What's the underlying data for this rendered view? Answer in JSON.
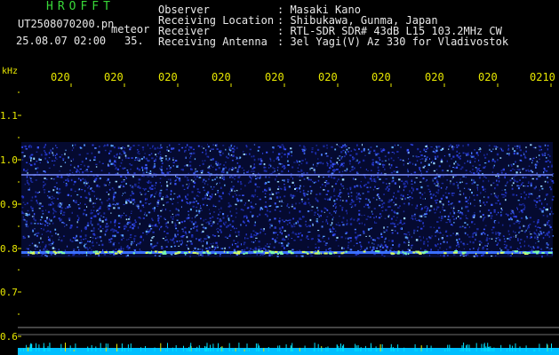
{
  "header": {
    "app_title": "HROFFT",
    "file_name": "UT2508070200.pn",
    "file_suffix": "meteor",
    "datetime": "25.08.07 02:00",
    "count": "35.",
    "info": [
      {
        "label": "Observer",
        "value": ": Masaki Kano"
      },
      {
        "label": "Receiving Location",
        "value": ": Shibukawa, Gunma, Japan"
      },
      {
        "label": "Receiver",
        "value": ": RTL-SDR SDR# 43dB L15 103.2MHz CW"
      },
      {
        "label": "Receiving Antenna",
        "value": ": 3el Yagi(V) Az 330 for Vladivostok"
      }
    ]
  },
  "axis": {
    "unit": "kHz",
    "time_ticks": [
      "020",
      "020",
      "020",
      "020",
      "020",
      "020",
      "020",
      "020",
      "020",
      "0210"
    ],
    "freq_ticks": [
      "1.1",
      "1.0",
      "0.9",
      "0.8",
      "0.7",
      "0.6"
    ]
  },
  "colors": {
    "header_green": "#38d838",
    "axis_yellow": "#e8e800",
    "noise_blue": "#1a2aa0",
    "signal_cyan": "#00e0ff"
  }
}
